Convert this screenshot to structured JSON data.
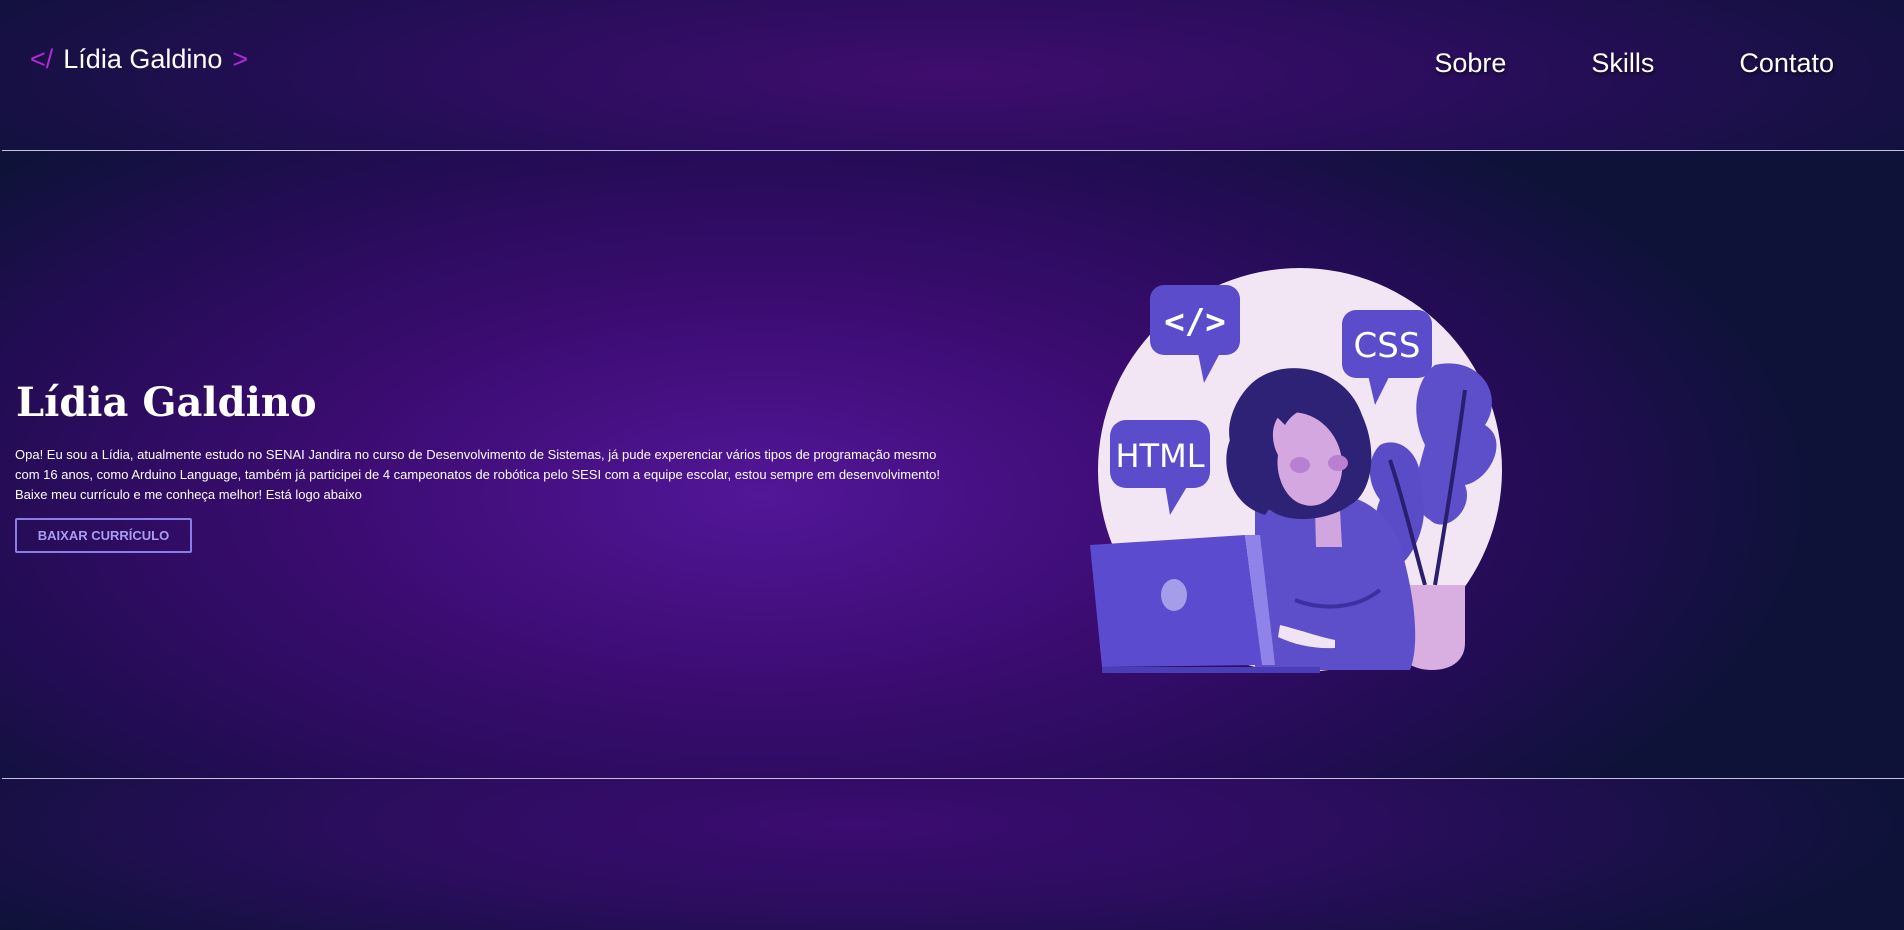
{
  "header": {
    "logo": {
      "open_bracket": "</",
      "name": "Lídia Galdino",
      "close_bracket": ">"
    },
    "nav": [
      {
        "label": "Sobre"
      },
      {
        "label": "Skills"
      },
      {
        "label": "Contato"
      }
    ]
  },
  "hero": {
    "title": "Lídia Galdino",
    "text": "Opa! Eu sou a Lídia, atualmente estudo no SENAI Jandira no curso de Desenvolvimento de Sistemas, já pude experenciar vários tipos de programação mesmo com 16 anos, como Arduino Language, também já participei de 4 campeonatos de robótica pelo SESI com a equipe escolar, estou sempre em desenvolvimento! Baixe meu currículo e me conheça melhor! Está logo abaixo",
    "cv_button": "BAIXAR CURRÍCULO"
  },
  "illustration": {
    "bubbles": [
      "</>",
      "CSS",
      "HTML"
    ]
  },
  "colors": {
    "accent_bracket": "#b02bd8",
    "button_border": "#8a7de6",
    "background_center": "#521698",
    "background_edge": "#0e1239"
  }
}
